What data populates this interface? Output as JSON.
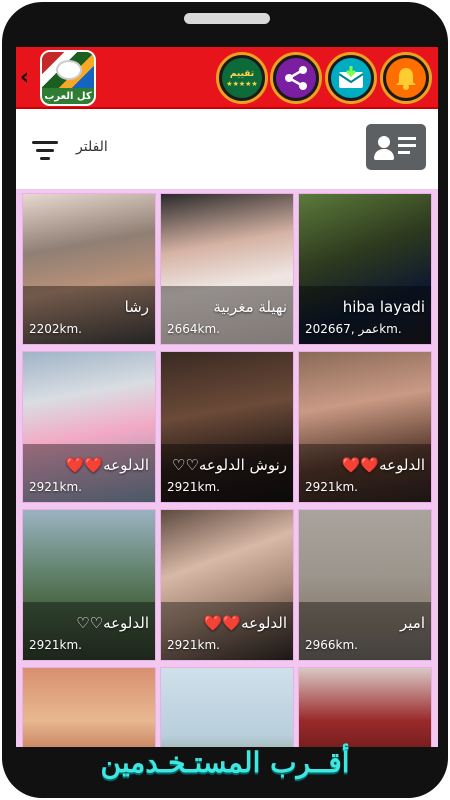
{
  "header": {
    "app_logo_text": "كل العرب",
    "rate_button_label": "تقييم",
    "rate_stars": "★★★★★",
    "back_icon": "chevron-left-icon",
    "share_icon": "share-icon",
    "message_icon": "message-icon",
    "bell_icon": "bell-icon"
  },
  "filter": {
    "label": "الفلتر",
    "sort_icon": "sort-icon",
    "contact_icon": "contact-card-icon"
  },
  "users": [
    {
      "name": "hiba layadi",
      "distance": "20عمر ,2667km."
    },
    {
      "name": "نهيلة مغربية",
      "distance": "2664km."
    },
    {
      "name": "رشا",
      "distance": "2202km."
    },
    {
      "name": "الدلوعه❤️❤️",
      "distance": "2921km."
    },
    {
      "name": "رنوش الدلوعه♡♡",
      "distance": "2921km."
    },
    {
      "name": "الدلوعه❤️❤️",
      "distance": "2921km."
    },
    {
      "name": "امير",
      "distance": "2966km."
    },
    {
      "name": "الدلوعه❤️❤️",
      "distance": "2921km."
    },
    {
      "name": "الدلوعه♡♡",
      "distance": "2921km."
    },
    {
      "name": "",
      "distance": ""
    },
    {
      "name": "",
      "distance": ""
    },
    {
      "name": "",
      "distance": ""
    }
  ],
  "footer": {
    "title": "أقــرب المستـخـدمين"
  },
  "colors": {
    "header_red": "#e8141c",
    "grid_bg": "#f2c8f0",
    "footer_cyan": "#3ee8e0"
  }
}
